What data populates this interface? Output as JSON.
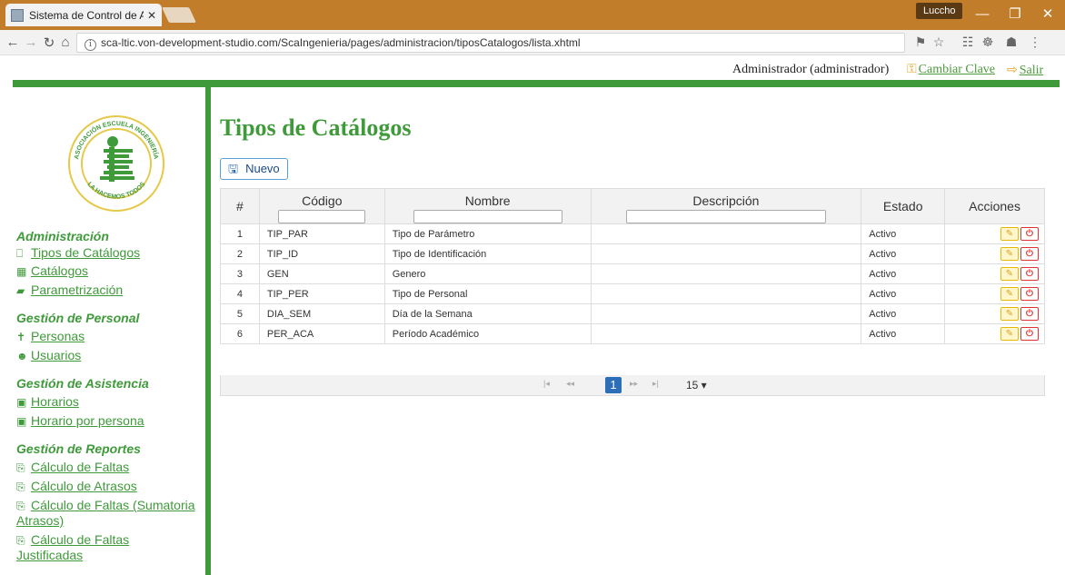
{
  "browser": {
    "tab_title": "Sistema de Control de A",
    "tab_close": "✕",
    "user_badge": "Luccho",
    "url": "sca-ltic.von-development-studio.com/ScaIngenieria/pages/administracion/tiposCatalogos/lista.xhtml",
    "minimize": "—",
    "maximize": "❐",
    "close": "✕"
  },
  "userbar": {
    "admin": "Administrador (administrador)",
    "change_password": "Cambiar Clave",
    "logout": "Salir"
  },
  "logo": {
    "top_text": "ASOCIACIÓN ESCUELA INGENIERÍA",
    "bottom_text": "LA HACEMOS TODOS"
  },
  "sidebar": {
    "sections": [
      {
        "title": "Administración",
        "items": [
          "Tipos de Catálogos",
          "Catálogos",
          "Parametrización"
        ]
      },
      {
        "title": "Gestión de Personal",
        "items": [
          "Personas",
          "Usuarios"
        ]
      },
      {
        "title": "Gestión de Asistencia",
        "items": [
          "Horarios",
          "Horario por persona"
        ]
      },
      {
        "title": "Gestión de Reportes",
        "items": [
          "Cálculo de Faltas",
          "Cálculo de Atrasos",
          "Cálculo de Faltas (Sumatoria",
          "Atrasos)",
          "Cálculo de Faltas",
          "Justificadas"
        ]
      }
    ]
  },
  "main": {
    "title": "Tipos de Catálogos",
    "new_button": "Nuevo",
    "columns": [
      "#",
      "Código",
      "Nombre",
      "Descripción",
      "Estado",
      "Acciones"
    ],
    "rows": [
      {
        "n": "1",
        "code": "TIP_PAR",
        "name": "Tipo de Parámetro",
        "desc": "",
        "status": "Activo"
      },
      {
        "n": "2",
        "code": "TIP_ID",
        "name": "Tipo de Identificación",
        "desc": "",
        "status": "Activo"
      },
      {
        "n": "3",
        "code": "GEN",
        "name": "Genero",
        "desc": "",
        "status": "Activo"
      },
      {
        "n": "4",
        "code": "TIP_PER",
        "name": "Tipo de Personal",
        "desc": "",
        "status": "Activo"
      },
      {
        "n": "5",
        "code": "DIA_SEM",
        "name": "Día de la Semana",
        "desc": "",
        "status": "Activo"
      },
      {
        "n": "6",
        "code": "PER_ACA",
        "name": "Período Académico",
        "desc": "",
        "status": "Activo"
      }
    ],
    "pager": {
      "current": "1",
      "rows_per_page": "15 ▾"
    }
  },
  "colors": {
    "brand_green": "#3f9a3a",
    "tab_orange": "#c27d2b",
    "primary_blue": "#2c6fb8"
  }
}
